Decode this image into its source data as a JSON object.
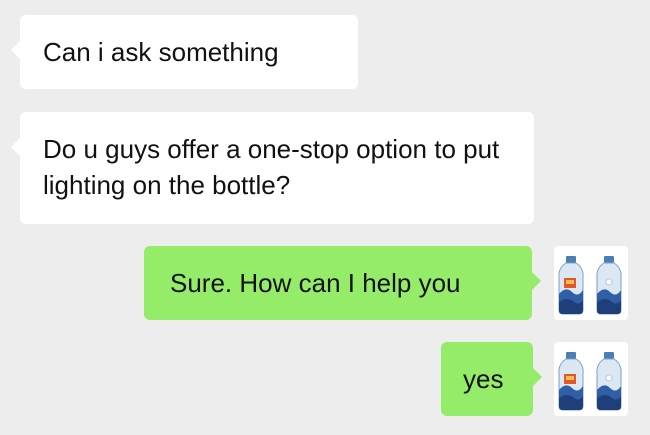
{
  "messages": [
    {
      "direction": "incoming",
      "text": "Can i ask something"
    },
    {
      "direction": "incoming",
      "text": "Do u guys offer a one-stop option to put lighting on the bottle?"
    },
    {
      "direction": "outgoing",
      "text": "Sure. How can I help you"
    },
    {
      "direction": "outgoing",
      "text": "yes"
    }
  ],
  "avatar": {
    "icon": "bottle-pair-avatar-icon"
  },
  "colors": {
    "background": "#ededed",
    "incoming_bubble": "#ffffff",
    "outgoing_bubble": "#95ec69",
    "text": "#111111"
  }
}
